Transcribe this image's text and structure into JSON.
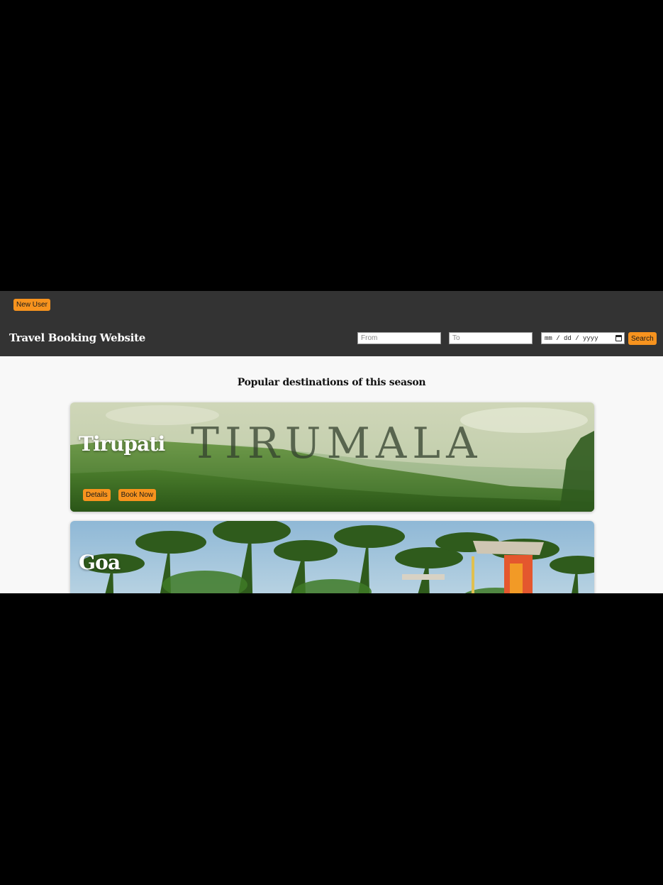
{
  "header": {
    "new_user_label": "New User",
    "site_title": "Travel Booking Website",
    "search": {
      "from_placeholder": "From",
      "to_placeholder": "To",
      "date_placeholder": "mm / dd / yyyy",
      "search_label": "Search"
    }
  },
  "main": {
    "section_title": "Popular destinations of this season",
    "destinations": [
      {
        "name": "Tirupati",
        "image_text": "TIRUMALA",
        "details_label": "Details",
        "book_label": "Book Now"
      },
      {
        "name": "Goa"
      }
    ]
  },
  "colors": {
    "header_bg": "#333333",
    "accent": "#f7931e",
    "page_bg": "#f8f8f8",
    "outer_bg": "#000000"
  }
}
